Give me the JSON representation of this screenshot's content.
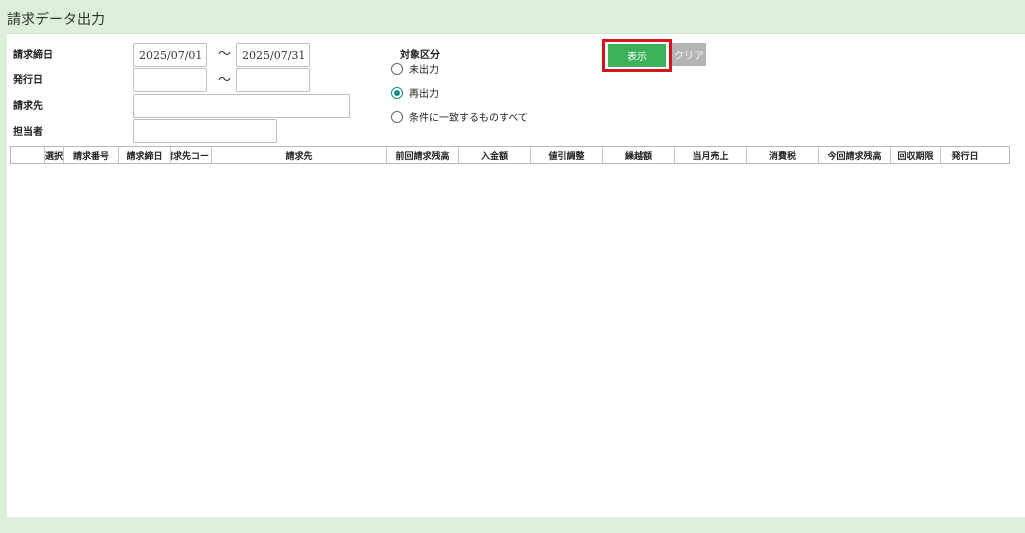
{
  "title": "請求データ出力",
  "form": {
    "billing_close_date_label": "請求締日",
    "billing_close_from": "2025/07/01",
    "billing_close_to": "2025/07/31",
    "issue_date_label": "発行日",
    "issue_date_from": "",
    "issue_date_to": "",
    "billing_to_label": "請求先",
    "billing_to_value": "",
    "person_in_charge_label": "担当者",
    "person_in_charge_value": "",
    "tilde": "～"
  },
  "target": {
    "label": "対象区分",
    "options": [
      {
        "label": "未出力",
        "checked": false
      },
      {
        "label": "再出力",
        "checked": true
      },
      {
        "label": "条件に一致するものすべて",
        "checked": false
      }
    ]
  },
  "buttons": {
    "show": "表示",
    "clear": "クリア"
  },
  "grid": {
    "columns": [
      "選択",
      "請求番号",
      "請求締日",
      "請求先コード",
      "請求先",
      "前回請求残高",
      "入金額",
      "値引調整",
      "繰越額",
      "当月売上",
      "消費税",
      "今回請求残高",
      "回収期限",
      "発行日"
    ]
  },
  "colors": {
    "header_bg": "#dcefd9",
    "show_button": "#3cb15a",
    "clear_button": "#b5b5b5",
    "highlight": "#d4151c"
  }
}
